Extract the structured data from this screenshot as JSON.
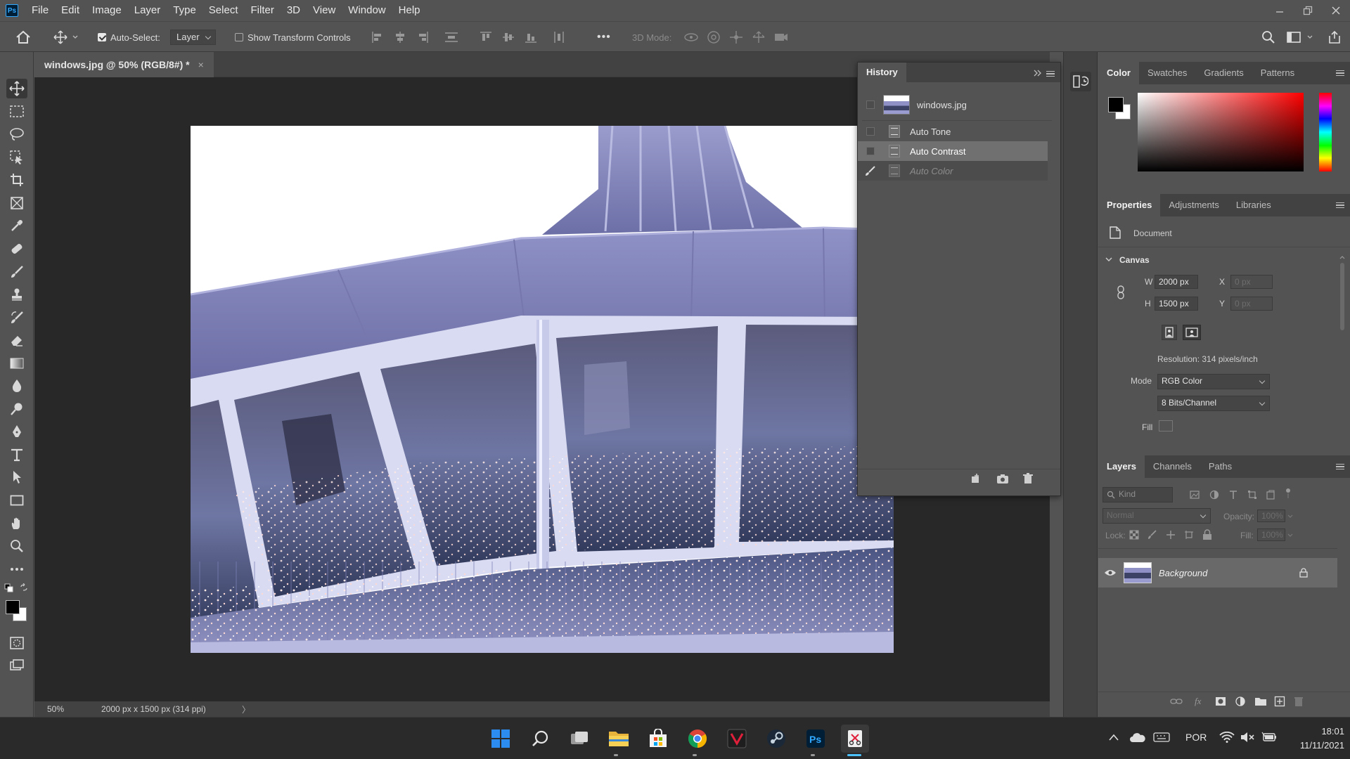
{
  "app": {
    "logo_text": "Ps"
  },
  "menu": [
    "File",
    "Edit",
    "Image",
    "Layer",
    "Type",
    "Select",
    "Filter",
    "3D",
    "View",
    "Window",
    "Help"
  ],
  "options_bar": {
    "auto_select_label": "Auto-Select:",
    "auto_select_checked": true,
    "target_value": "Layer",
    "show_transform_label": "Show Transform Controls",
    "show_transform_checked": false,
    "more": "•••",
    "mode_3d_label": "3D Mode:"
  },
  "document": {
    "tab_title": "windows.jpg @ 50% (RGB/8#) *",
    "close_glyph": "×",
    "zoom": "50%",
    "info": "2000 px x 1500 px (314 ppi)",
    "info_arrow": "〉"
  },
  "history": {
    "tab": "History",
    "snapshot": "windows.jpg",
    "states": [
      {
        "label": "Auto Tone",
        "state": "normal"
      },
      {
        "label": "Auto Contrast",
        "state": "selected"
      },
      {
        "label": "Auto Color",
        "state": "undone"
      }
    ]
  },
  "color_panel": {
    "tabs": [
      "Color",
      "Swatches",
      "Gradients",
      "Patterns"
    ],
    "active": "Color"
  },
  "properties_panel": {
    "tabs": [
      "Properties",
      "Adjustments",
      "Libraries"
    ],
    "active": "Properties",
    "document_label": "Document",
    "section": "Canvas",
    "w_label": "W",
    "w_value": "2000 px",
    "h_label": "H",
    "h_value": "1500 px",
    "x_label": "X",
    "x_value": "0 px",
    "y_label": "Y",
    "y_value": "0 px",
    "resolution": "Resolution: 314 pixels/inch",
    "mode_label": "Mode",
    "mode_value": "RGB Color",
    "depth_value": "8 Bits/Channel",
    "fill_label": "Fill"
  },
  "layers_panel": {
    "tabs": [
      "Layers",
      "Channels",
      "Paths"
    ],
    "active": "Layers",
    "filter_kind": "Kind",
    "blend_mode": "Normal",
    "opacity_label": "Opacity:",
    "opacity_value": "100%",
    "lock_label": "Lock:",
    "fill_label": "Fill:",
    "fill_value": "100%",
    "layer_name": "Background"
  },
  "taskbar": {
    "language": "POR",
    "time": "18:01",
    "date": "11/11/2021"
  }
}
